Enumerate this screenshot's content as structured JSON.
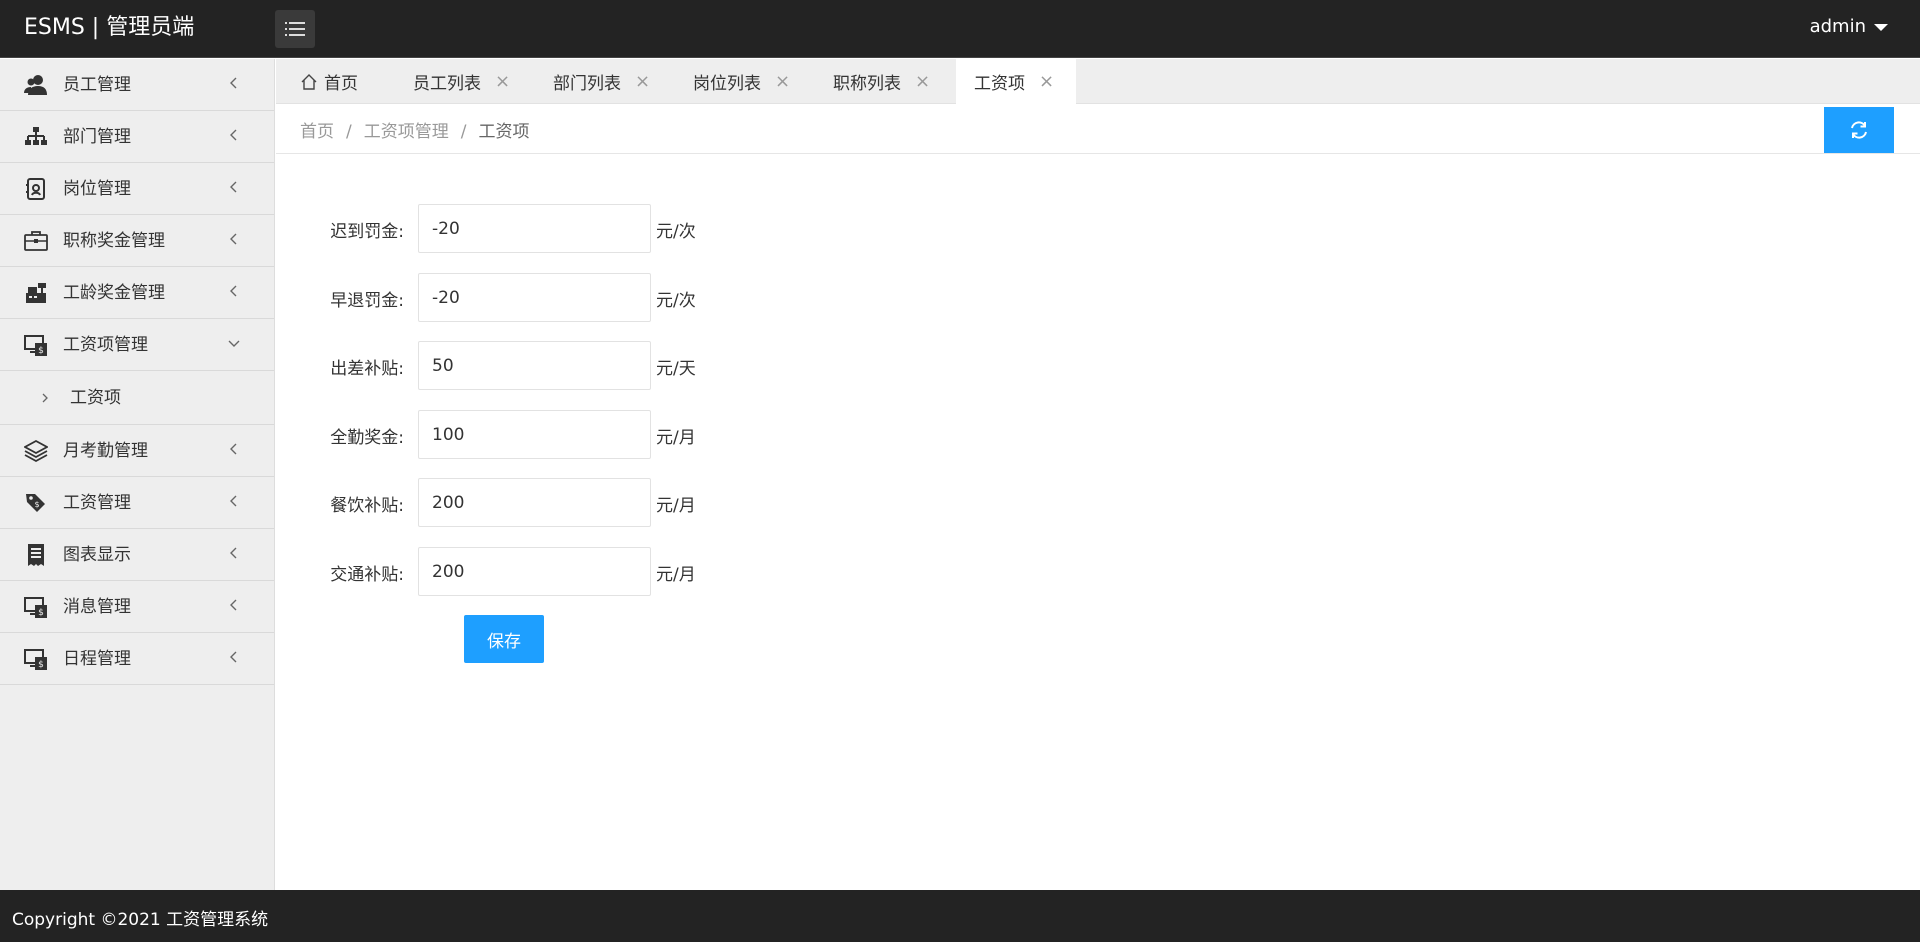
{
  "header": {
    "brand": "ESMS | 管理员端",
    "user": "admin"
  },
  "sidebar": {
    "items": [
      {
        "label": "员工管理",
        "icon": "users-icon"
      },
      {
        "label": "部门管理",
        "icon": "sitemap-icon"
      },
      {
        "label": "岗位管理",
        "icon": "id-badge-icon"
      },
      {
        "label": "职称奖金管理",
        "icon": "briefcase-icon"
      },
      {
        "label": "工龄奖金管理",
        "icon": "cash-register-icon"
      },
      {
        "label": "工资项管理",
        "icon": "salary-monitor-icon",
        "expanded": true,
        "children": [
          {
            "label": "工资项"
          }
        ]
      },
      {
        "label": "月考勤管理",
        "icon": "layers-icon"
      },
      {
        "label": "工资管理",
        "icon": "tags-icon"
      },
      {
        "label": "图表显示",
        "icon": "receipt-icon"
      },
      {
        "label": "消息管理",
        "icon": "message-monitor-icon"
      },
      {
        "label": "日程管理",
        "icon": "schedule-monitor-icon"
      }
    ]
  },
  "tabs": [
    {
      "label": "首页",
      "closable": false
    },
    {
      "label": "员工列表",
      "closable": true
    },
    {
      "label": "部门列表",
      "closable": true
    },
    {
      "label": "岗位列表",
      "closable": true
    },
    {
      "label": "职称列表",
      "closable": true
    },
    {
      "label": "工资项",
      "closable": true,
      "active": true
    }
  ],
  "breadcrumb": {
    "home": "首页",
    "section": "工资项管理",
    "current": "工资项",
    "separator": "/"
  },
  "form": {
    "fields": [
      {
        "label": "迟到罚金:",
        "value": "-20",
        "unit": "元/次"
      },
      {
        "label": "早退罚金:",
        "value": "-20",
        "unit": "元/次"
      },
      {
        "label": "出差补贴:",
        "value": "50",
        "unit": "元/天"
      },
      {
        "label": "全勤奖金:",
        "value": "100",
        "unit": "元/月"
      },
      {
        "label": "餐饮补贴:",
        "value": "200",
        "unit": "元/月"
      },
      {
        "label": "交通补贴:",
        "value": "200",
        "unit": "元/月"
      }
    ],
    "save_label": "保存"
  },
  "footer": {
    "copyright": "Copyright ©2021 工资管理系统"
  },
  "colors": {
    "header_bg": "#232323",
    "sidebar_bg": "#eeeeee",
    "accent": "#1e9fff"
  }
}
